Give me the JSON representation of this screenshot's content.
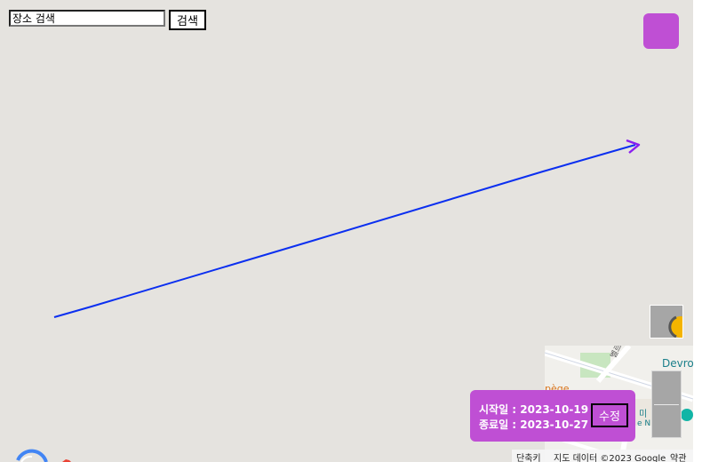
{
  "search": {
    "placeholder": "장소 검색",
    "button_label": "검색"
  },
  "date_panel": {
    "start_label": "시작일",
    "start_date": "2023-10-19",
    "end_label": "종료일",
    "end_date": "2023-10-27",
    "separator": " : ",
    "edit_label": "수정"
  },
  "minimap": {
    "place_label": "Devro",
    "street_label": "벨르사",
    "orange_label": "pège",
    "poi_letter": "미",
    "poi_fragment": "e N"
  },
  "attribution": {
    "shortcuts": "단축키",
    "map_data": "지도 데이터 ©2023 Google",
    "terms": "약관"
  },
  "colors": {
    "map_background": "#e5e3df",
    "accent_purple": "#bf4fd4",
    "route_blue": "#0b2ff0",
    "arrow_purple": "#8a1df0"
  },
  "icons": {
    "streetview": "pegman-icon",
    "logo": "google-logo"
  }
}
